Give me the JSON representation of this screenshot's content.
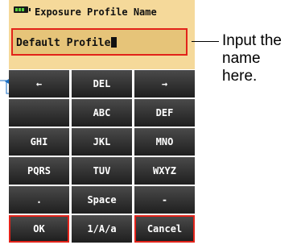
{
  "header": {
    "title": "Exposure Profile Name",
    "battery_icon": "battery-icon"
  },
  "input": {
    "value": "Default Profile"
  },
  "keys": [
    [
      "←",
      "DEL",
      "→"
    ],
    [
      "",
      "ABC",
      "DEF"
    ],
    [
      "GHI",
      "JKL",
      "MNO"
    ],
    [
      "PQRS",
      "TUV",
      "WXYZ"
    ],
    [
      ".",
      "Space",
      "-"
    ],
    [
      "OK",
      "1/A/a",
      "Cancel"
    ]
  ],
  "callout": {
    "text": "Input the name here."
  },
  "colors": {
    "screen_bg": "#f5d99a",
    "input_bg": "#e6c479",
    "highlight": "#e2231a",
    "key_bg": "#2b2b2b",
    "callout_marker": "#1a6fc4"
  }
}
